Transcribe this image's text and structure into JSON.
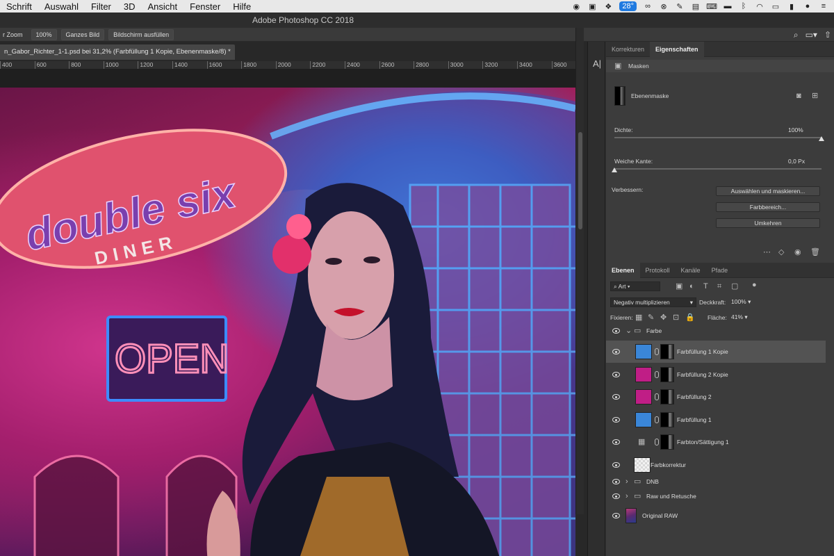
{
  "menubar": {
    "items": [
      "Schrift",
      "Auswahl",
      "Filter",
      "3D",
      "Ansicht",
      "Fenster",
      "Hilfe"
    ],
    "temperature": "28°"
  },
  "window": {
    "title": "Adobe Photoshop CC 2018"
  },
  "options": {
    "zoom_label": "r Zoom",
    "zoom_value": "100%",
    "fit_label": "Ganzes Bild",
    "fill_label": "Bildschirm ausfüllen"
  },
  "document": {
    "tab_title": "n_Gabor_Richter_1-1.psd bei 31,2% (Farbfüllung 1 Kopie, Ebenenmaske/8) *",
    "ruler_ticks": [
      "400",
      "600",
      "800",
      "1000",
      "1200",
      "1400",
      "1600",
      "1800",
      "2000",
      "2200",
      "2400",
      "2600",
      "2800",
      "3000",
      "3200",
      "3400",
      "3600"
    ]
  },
  "photo": {
    "sign_text": "double six",
    "sign_sub": "DINER",
    "neon_text": "OPEN"
  },
  "properties": {
    "tabs": [
      "Korrekturen",
      "Eigenschaften"
    ],
    "active_tab": 1,
    "section_title": "Masken",
    "mask_label": "Ebenenmaske",
    "density_label": "Dichte:",
    "density_value": "100%",
    "density_fraction": 1.0,
    "feather_label": "Weiche Kante:",
    "feather_value": "0,0 Px",
    "feather_fraction": 0.0,
    "refine_label": "Verbessern:",
    "buttons": [
      "Auswählen und maskieren...",
      "Farbbereich...",
      "Umkehren"
    ]
  },
  "layers": {
    "tabs": [
      "Ebenen",
      "Protokoll",
      "Kanäle",
      "Pfade"
    ],
    "active_tab": 0,
    "filter_label": "Art",
    "blend_mode": "Negativ multiplizieren",
    "opacity_label": "Deckkraft:",
    "opacity_value": "100%",
    "lock_label": "Fixieren:",
    "fill_label": "Fläche:",
    "fill_value": "41%",
    "items": [
      {
        "name": "Farbe",
        "kind": "group",
        "expanded": true
      },
      {
        "name": "Farbfüllung 1 Kopie",
        "kind": "fill",
        "color": "#3a86d8",
        "selected": true
      },
      {
        "name": "Farbfüllung 2 Kopie",
        "kind": "fill",
        "color": "#c01e86"
      },
      {
        "name": "Farbfüllung 2",
        "kind": "fill",
        "color": "#c01e86"
      },
      {
        "name": "Farbfüllung 1",
        "kind": "fill",
        "color": "#3a86d8"
      },
      {
        "name": "Farbton/Sättigung 1",
        "kind": "adjustment"
      },
      {
        "name": "Farbkorrektur",
        "kind": "empty"
      },
      {
        "name": "DNB",
        "kind": "group",
        "expanded": false
      },
      {
        "name": "Raw und Retusche",
        "kind": "group",
        "expanded": false
      },
      {
        "name": "Original RAW",
        "kind": "image"
      }
    ]
  }
}
